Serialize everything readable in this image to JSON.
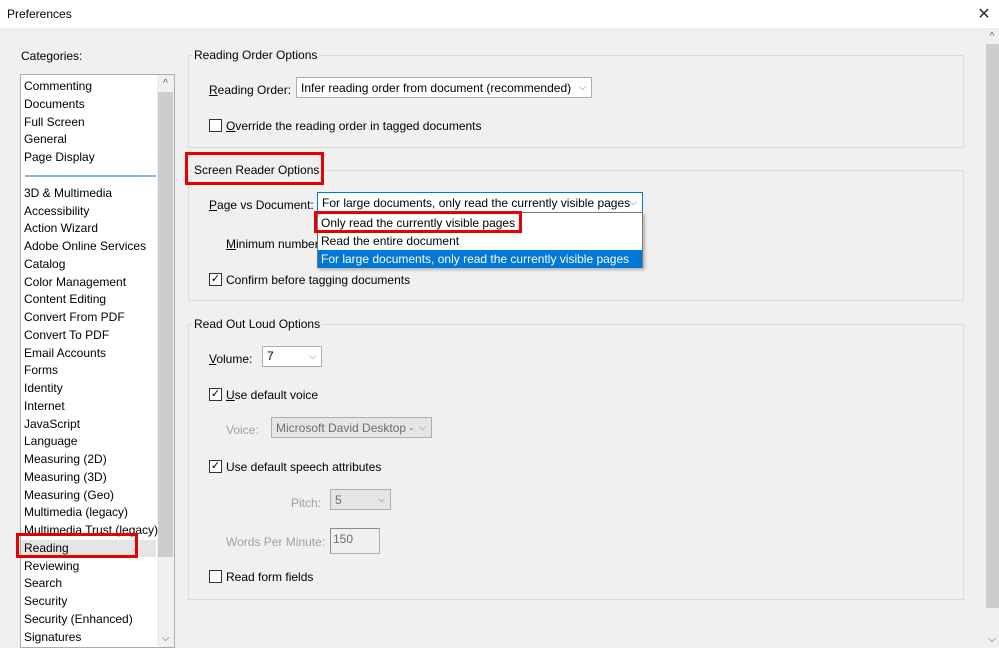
{
  "window": {
    "title": "Preferences",
    "close_icon": "close-icon"
  },
  "categories": {
    "label": "Categories:",
    "group1": [
      "Commenting",
      "Documents",
      "Full Screen",
      "General",
      "Page Display"
    ],
    "group2": [
      "3D & Multimedia",
      "Accessibility",
      "Action Wizard",
      "Adobe Online Services",
      "Catalog",
      "Color Management",
      "Content Editing",
      "Convert From PDF",
      "Convert To PDF",
      "Email Accounts",
      "Forms",
      "Identity",
      "Internet",
      "JavaScript",
      "Language",
      "Measuring (2D)",
      "Measuring (3D)",
      "Measuring (Geo)",
      "Multimedia (legacy)",
      "Multimedia Trust (legacy)",
      "Reading",
      "Reviewing",
      "Search",
      "Security",
      "Security (Enhanced)",
      "Signatures"
    ],
    "selected": "Reading"
  },
  "reading_order_options": {
    "title": "Reading Order Options",
    "reading_order_label": "Reading Order:",
    "reading_order_value": "Infer reading order from document (recommended)",
    "override_label": "Override the reading order in tagged documents",
    "override_checked": false
  },
  "screen_reader_options": {
    "title": "Screen Reader Options",
    "page_vs_document_label": "Page vs Document:",
    "page_vs_document_value": "For large documents, only read the currently visible pages",
    "dropdown_options": [
      "Only read the currently visible pages",
      "Read the entire document",
      "For large documents, only read the currently visible pages"
    ],
    "highlighted_option": "For large documents, only read the currently visible pages",
    "minimum_number_label": "Minimum number",
    "confirm_tagging_label": "Confirm before tagging documents",
    "confirm_tagging_checked": true
  },
  "read_out_loud_options": {
    "title": "Read Out Loud Options",
    "volume_label": "Volume:",
    "volume_value": "7",
    "use_default_voice_label": "Use default voice",
    "use_default_voice_checked": true,
    "voice_label": "Voice:",
    "voice_value": "Microsoft David Desktop - E",
    "use_default_speech_label": "Use default speech attributes",
    "use_default_speech_checked": true,
    "pitch_label": "Pitch:",
    "pitch_value": "5",
    "wpm_label": "Words Per Minute:",
    "wpm_value": "150",
    "read_form_fields_label": "Read form fields",
    "read_form_fields_checked": false
  },
  "glyphs": {
    "check": "✓",
    "chevron_down": "⌵",
    "chevron_up": "^",
    "close": "✕"
  },
  "colors": {
    "highlight_annotation": "#e80000",
    "selection_blue": "#0078d7"
  }
}
